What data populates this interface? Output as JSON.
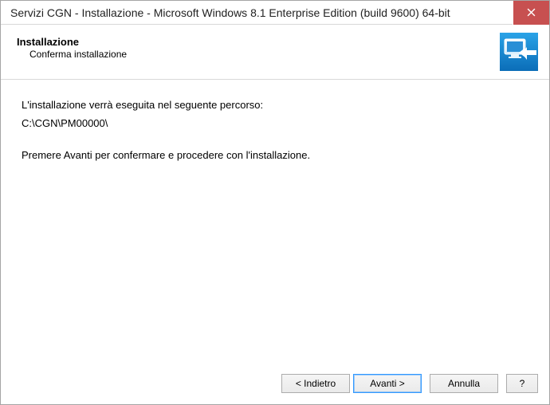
{
  "titlebar": {
    "title": "Servizi CGN - Installazione - Microsoft Windows 8.1 Enterprise Edition (build 9600) 64-bit"
  },
  "header": {
    "title": "Installazione",
    "subtitle": "Conferma installazione"
  },
  "content": {
    "line1": "L'installazione verrà eseguita nel seguente percorso:",
    "path": "C:\\CGN\\PM00000\\",
    "instruction": "Premere Avanti per confermare e procedere con l'installazione."
  },
  "footer": {
    "back": "< Indietro",
    "next": "Avanti >",
    "cancel": "Annulla",
    "help": "?"
  }
}
